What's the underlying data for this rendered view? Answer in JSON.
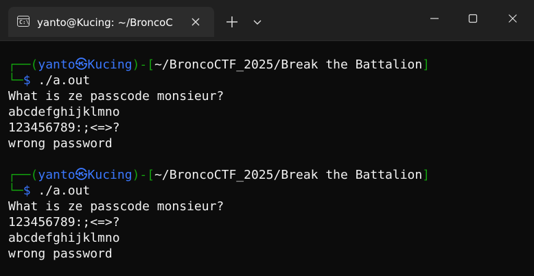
{
  "window": {
    "tab_title": "yanto@Kucing: ~/BroncoC",
    "tab_close_glyph": "✕",
    "new_tab_glyph": "+",
    "icons": {
      "tab": "terminal-icon",
      "close_tab": "close-icon",
      "new_tab": "plus-icon",
      "dropdown": "chevron-down-icon",
      "minimize": "minimize-icon",
      "maximize": "maximize-icon",
      "close": "close-icon"
    }
  },
  "colors": {
    "background": "#0c0c0c",
    "titlebar": "#202020",
    "prompt_frame": "#13a10e",
    "prompt_user": "#3b78ff",
    "text": "#f2f2f2"
  },
  "terminal": {
    "sessions": [
      {
        "prompt": {
          "frame_top": "┌──(",
          "user": "yanto",
          "at": "㉿",
          "host": "Kucing",
          "sep": ")-[",
          "path": "~/BroncoCTF_2025/Break the Battalion",
          "close": "]",
          "frame_bottom": "└─",
          "dollar": "$",
          "command": " ./a.out"
        },
        "output": [
          "What is ze passcode monsieur?",
          "abcdefghijklmno",
          "123456789:;<=>?",
          "wrong password"
        ]
      },
      {
        "prompt": {
          "frame_top": "┌──(",
          "user": "yanto",
          "at": "㉿",
          "host": "Kucing",
          "sep": ")-[",
          "path": "~/BroncoCTF_2025/Break the Battalion",
          "close": "]",
          "frame_bottom": "└─",
          "dollar": "$",
          "command": " ./a.out"
        },
        "output": [
          "What is ze passcode monsieur?",
          "123456789:;<=>?",
          "abcdefghijklmno",
          "wrong password"
        ]
      }
    ]
  }
}
